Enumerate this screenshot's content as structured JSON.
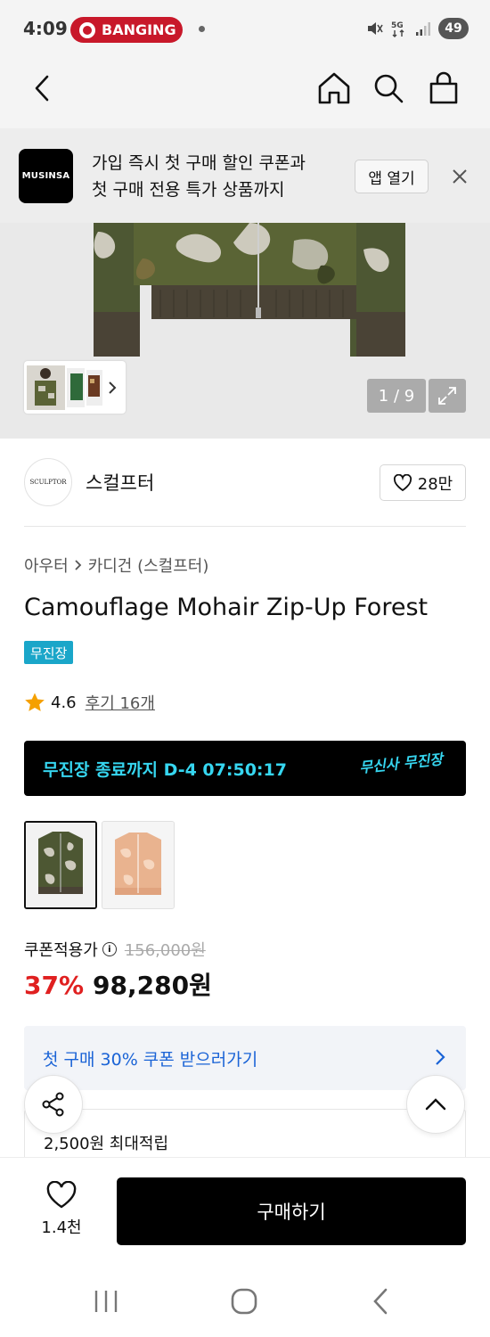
{
  "status_bar": {
    "time": "4:09",
    "notification_pill": "BANGING",
    "battery": "49",
    "network": "5G"
  },
  "nav": {
    "icons": [
      "back-icon",
      "home-icon",
      "search-icon",
      "bag-icon"
    ]
  },
  "banner": {
    "logo": "MUSINSA",
    "line1": "가입 즉시 첫 구매 할인 쿠폰과",
    "line2": "첫 구매 전용 특가 상품까지",
    "open_app": "앱 열기"
  },
  "gallery": {
    "page_indicator": "1 / 9"
  },
  "brand": {
    "logo_text": "SCULPTOR",
    "name": "스컬프터",
    "likes": "28만"
  },
  "breadcrumb": {
    "cat1": "아우터",
    "sep": "›",
    "cat2": "카디건 (스컬프터)"
  },
  "product": {
    "title": "Camouflage Mohair Zip-Up Forest",
    "badge": "무진장",
    "rating": "4.6",
    "reviews": "후기 16개"
  },
  "timer": {
    "text": "무진장 종료까지 D-4 07:50:17",
    "logo": "무신사 무진장"
  },
  "pricing": {
    "label": "쿠폰적용가",
    "original": "156,000원",
    "discount": "37%",
    "price": "98,280원"
  },
  "coupon": {
    "text": "첫 구매 30% 쿠폰 받으러가기"
  },
  "points": {
    "text": "2,500원 최대적립"
  },
  "bottom": {
    "wish_count": "1.4천",
    "buy": "구매하기"
  },
  "colors": {
    "accent_cyan": "#36d6f0",
    "badge": "#1aa6c9",
    "discount_red": "#e02020",
    "coupon_blue": "#1a63d6"
  }
}
